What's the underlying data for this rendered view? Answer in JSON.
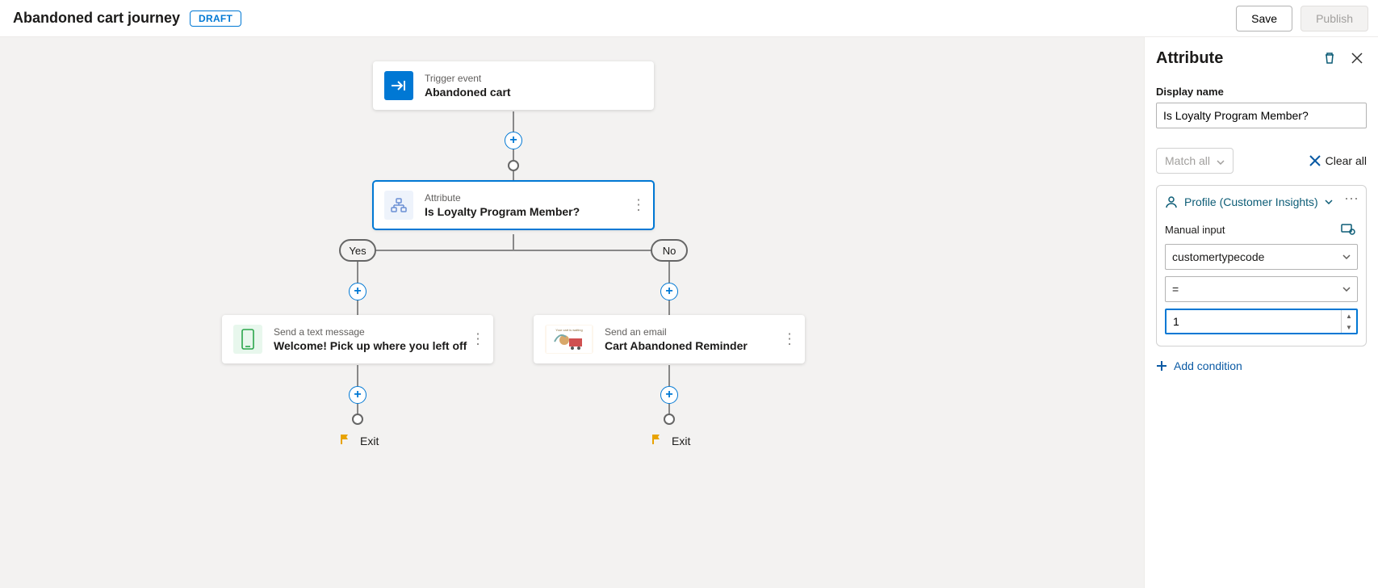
{
  "header": {
    "title": "Abandoned cart journey",
    "status_badge": "DRAFT",
    "save_label": "Save",
    "publish_label": "Publish"
  },
  "canvas": {
    "trigger": {
      "caption": "Trigger event",
      "title": "Abandoned cart"
    },
    "attribute": {
      "caption": "Attribute",
      "title": "Is Loyalty Program Member?"
    },
    "branch_yes": "Yes",
    "branch_no": "No",
    "sms": {
      "caption": "Send a text message",
      "title": "Welcome! Pick up where you left off"
    },
    "email": {
      "caption": "Send an email",
      "title": "Cart Abandoned Reminder"
    },
    "exit_label": "Exit"
  },
  "panel": {
    "title": "Attribute",
    "display_name_label": "Display name",
    "display_name_value": "Is Loyalty Program Member?",
    "match_label": "Match all",
    "clear_all_label": "Clear all",
    "profile_label": "Profile (Customer Insights)",
    "manual_input_label": "Manual input",
    "field_value": "customertypecode",
    "operator_value": "=",
    "number_value": "1",
    "add_condition_label": "Add condition"
  }
}
